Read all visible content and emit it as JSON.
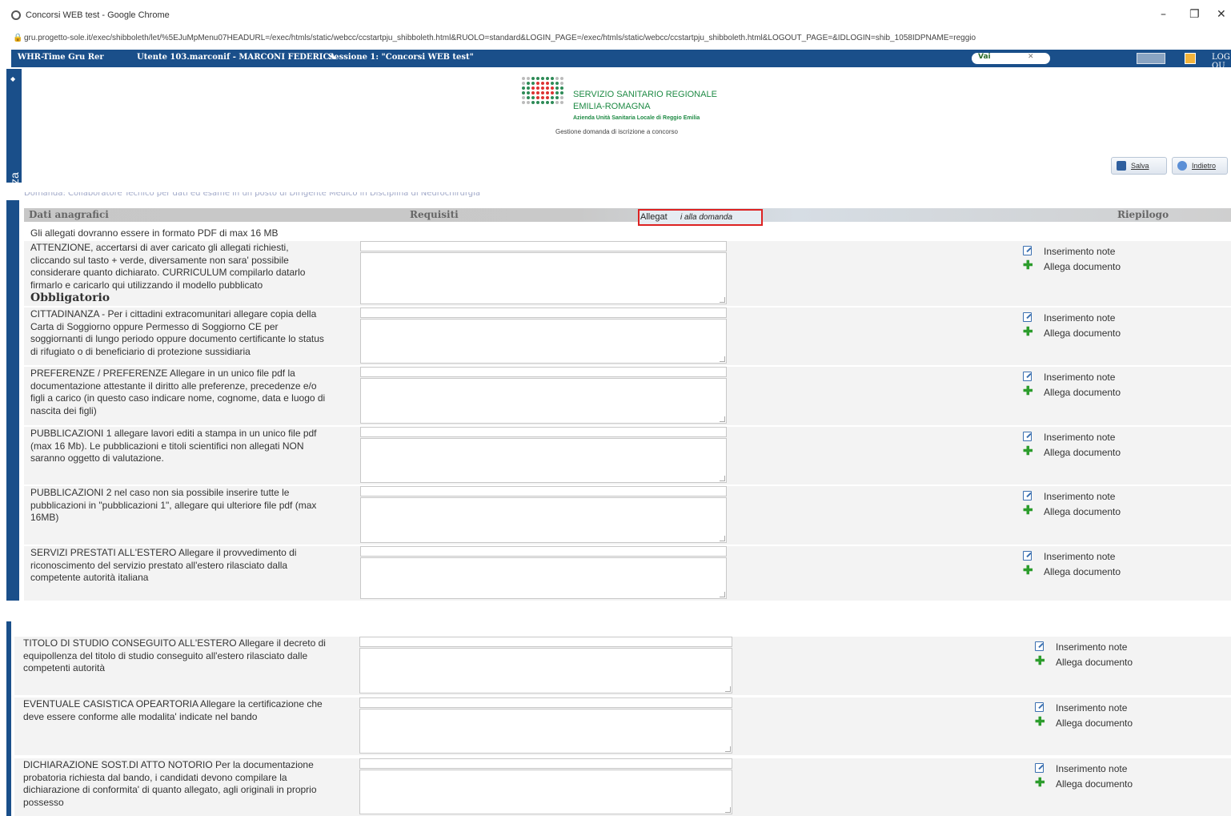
{
  "browser": {
    "title": "Concorsi WEB test - Google Chrome",
    "url": "gru.progetto-sole.it/exec/shibboleth/let/%5EJuMpMenu07HEADURL=/exec/htmls/static/webcc/ccstartpju_shibboleth.html&RUOLO=standard&LOGIN_PAGE=/exec/htmls/static/webcc/ccstartpju_shibboleth.html&LOGOUT_PAGE=&IDLOGIN=shib_1058IDPNAME=reggio",
    "minimize": "–",
    "maximize": "❐",
    "close": "✕"
  },
  "app_header": {
    "app_name": "WHR-Time Gru Rer",
    "user": "Utente 103.marconif - MARCONI FEDERICA",
    "session": "Sessione 1: \"Concorsi WEB test\"",
    "search_go": "Vai",
    "logout": "LOG OU"
  },
  "side_tab": {
    "label": "Visualizza"
  },
  "logo": {
    "line1": "SERVIZIO SANITARIO REGIONALE",
    "line2": "EMILIA-ROMAGNA",
    "line3": "Azienda Unità Sanitaria Locale di Reggio Emilia",
    "line4": "Gestione domanda di iscrizione a concorso"
  },
  "actions": {
    "save": "Salva",
    "back": "Indietro"
  },
  "clipped_header": "Domanda: Collaboratore Tecnico per dati ed esame in un posto di Dirigente Medico in Disciplina di Neurochirurgia",
  "tabs": {
    "dati": "Dati anagrafici",
    "requisiti": "Requisiti",
    "allegati_a": "Allegat",
    "allegati_b": "i alla domanda",
    "riepilogo": "Riepilogo"
  },
  "intro": "Gli allegati dovranno essere in formato PDF di max 16 MB",
  "row_actions": {
    "notes": "Inserimento note",
    "attach": "Allega documento"
  },
  "rows": [
    {
      "lines": [
        "ATTENZIONE, accertarsi di aver caricato gli allegati richiesti,",
        "cliccando sul tasto + verde, diversamente non sara' possibile",
        "considerare quanto dichiarato. CURRICULUM compilarlo datarlo",
        "firmarlo e caricarlo qui utilizzando il modello pubblicato"
      ],
      "mandatory": "Obbligatorio"
    },
    {
      "lines": [
        "CITTADINANZA - Per i cittadini extracomunitari allegare copia della",
        "Carta di Soggiorno oppure Permesso di Soggiorno CE per",
        "soggiornanti di lungo periodo oppure documento certificante lo status",
        "di rifugiato o di beneficiario di protezione sussidiaria"
      ]
    },
    {
      "lines": [
        "PREFERENZE / PREFERENZE Allegare in un unico file pdf la",
        "documentazione attestante il diritto alle preferenze, precedenze e/o",
        "figli a carico (in questo caso indicare nome, cognome, data e luogo di",
        "nascita dei figli)"
      ]
    },
    {
      "lines": [
        "PUBBLICAZIONI 1 allegare lavori editi a stampa in un unico file pdf",
        "(max 16 Mb). Le pubblicazioni e titoli scientifici non allegati NON",
        "saranno oggetto di valutazione."
      ]
    },
    {
      "lines": [
        "PUBBLICAZIONI 2 nel caso non sia possibile inserire tutte le",
        "pubblicazioni in \"pubblicazioni 1\", allegare qui ulteriore file pdf (max",
        "16MB)"
      ]
    },
    {
      "lines": [
        "SERVIZI PRESTATI ALL'ESTERO Allegare il provvedimento di",
        "riconoscimento del servizio prestato all'estero rilasciato dalla",
        "competente autorità italiana"
      ]
    },
    {
      "lines": [
        "TITOLO DI STUDIO CONSEGUITO ALL'ESTERO Allegare il decreto di",
        "equipollenza del titolo di studio conseguito all'estero rilasciato dalle",
        "competenti autorità"
      ]
    },
    {
      "lines": [
        "EVENTUALE CASISTICA OPEARTORIA Allegare la certificazione che",
        "deve essere conforme alle modalita' indicate nel bando"
      ]
    },
    {
      "lines": [
        "DICHIARAZIONE SOST.DI ATTO NOTORIO Per la documentazione",
        "probatoria richiesta dal bando, i candidati devono compilare la",
        "dichiarazione di conformita' di quanto allegato, agli originali in proprio",
        "possesso"
      ]
    }
  ]
}
